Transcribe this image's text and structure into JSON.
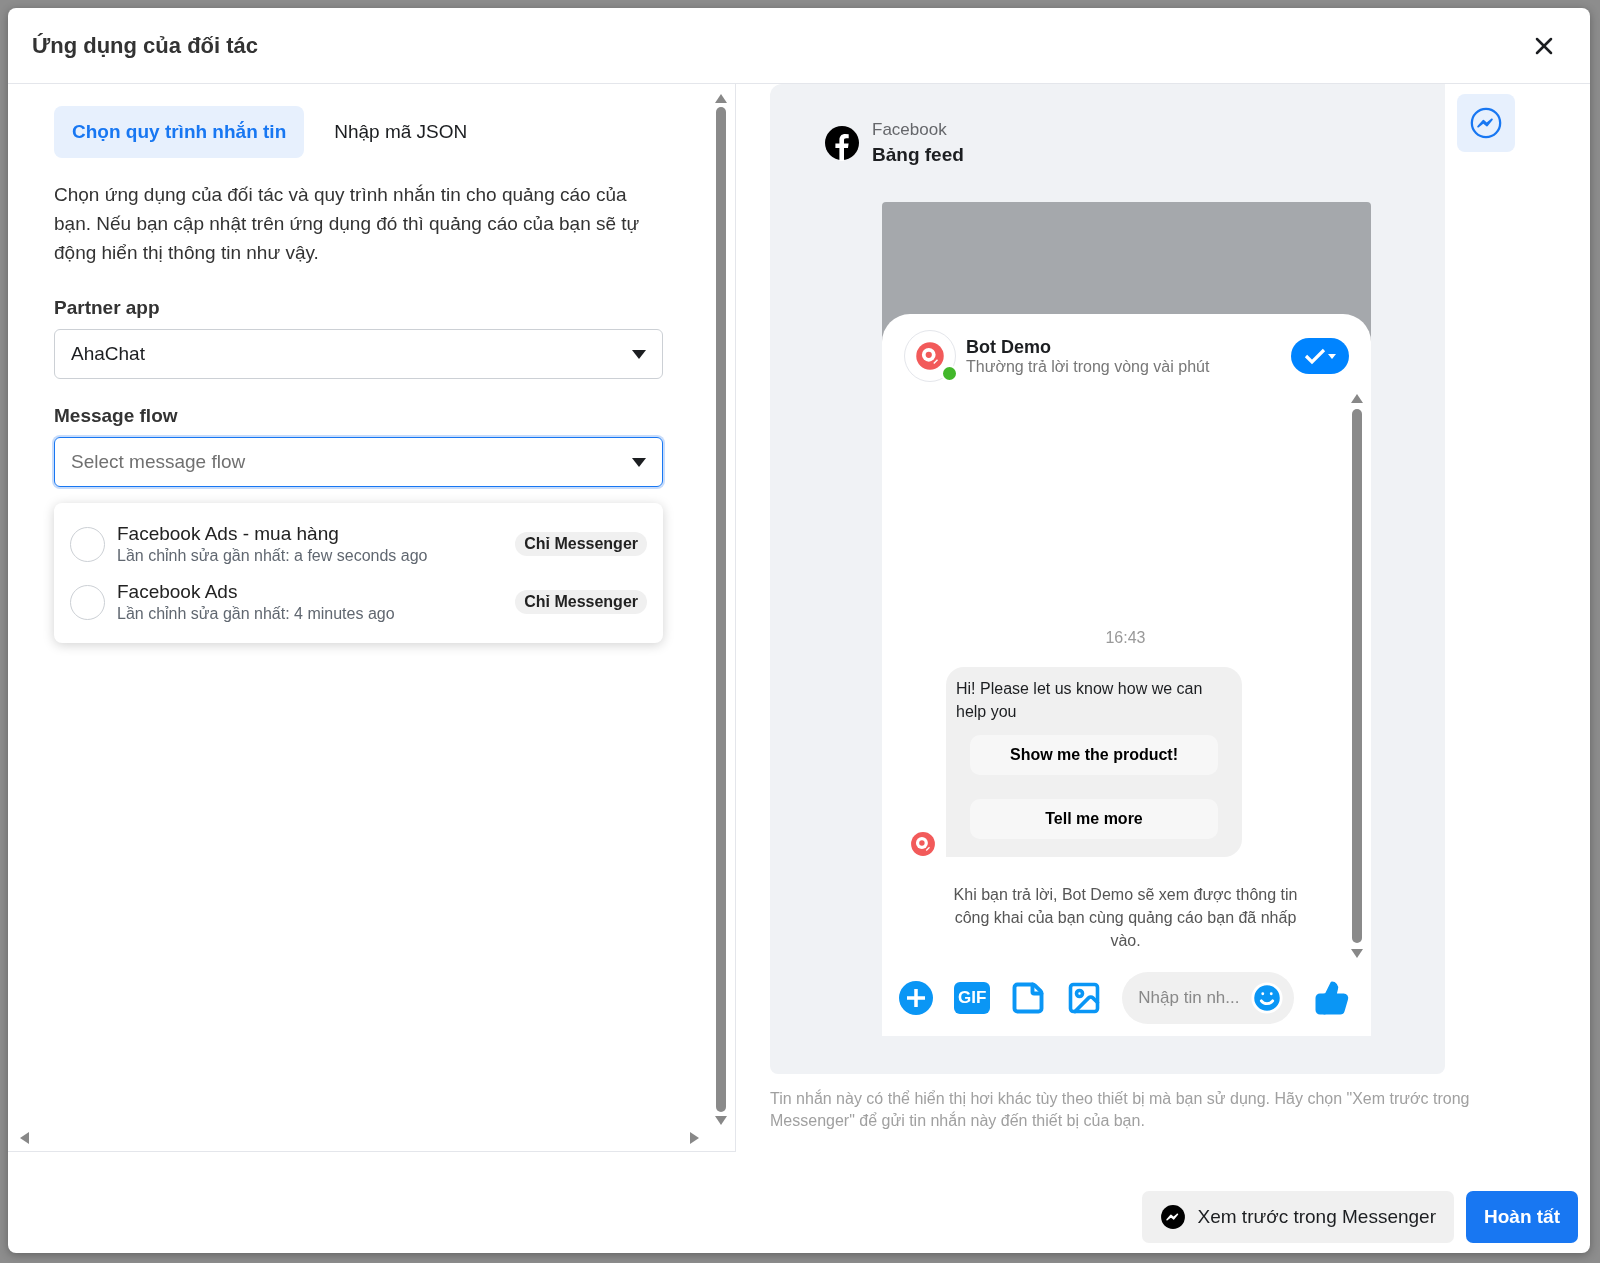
{
  "dialog": {
    "title": "Ứng dụng của đối tác"
  },
  "tabs": [
    {
      "label": "Chọn quy trình nhắn tin",
      "selected": true
    },
    {
      "label": "Nhập mã JSON",
      "selected": false
    }
  ],
  "description": "Chọn ứng dụng của đối tác và quy trình nhắn tin cho quảng cáo của bạn. Nếu bạn cập nhật trên ứng dụng đó thì quảng cáo của bạn sẽ tự động hiển thị thông tin như vậy.",
  "partner_app": {
    "label": "Partner app",
    "value": "AhaChat"
  },
  "message_flow": {
    "label": "Message flow",
    "placeholder": "Select message flow",
    "focused": true
  },
  "flow_options": [
    {
      "name": "Facebook Ads - mua hàng",
      "edited": "Lần chỉnh sửa gần nhất: a few seconds ago",
      "badge": "Chỉ Messenger",
      "selected": false
    },
    {
      "name": "Facebook Ads",
      "edited": "Lần chỉnh sửa gần nhất: 4 minutes ago",
      "badge": "Chỉ Messenger",
      "selected": false
    }
  ],
  "preview": {
    "platform": "Facebook",
    "placement": "Bảng feed",
    "page_name": "Bot Demo",
    "status": "Thường trả lời trong vòng vài phút",
    "online": true,
    "time": "16:43",
    "message": "Hi! Please let us know how we can help you",
    "quick_replies": [
      "Show me the product!",
      "Tell me more"
    ],
    "notice": "Khi bạn trả lời, Bot Demo sẽ xem được thông tin công khai của bạn cùng quảng cáo bạn đã nhấp vào.",
    "gif_label": "GIF",
    "composer_placeholder": "Nhập tin nh..."
  },
  "preview_note": "Tin nhắn này có thể hiển thị hơi khác tùy theo thiết bị mà bạn sử dụng. Hãy chọn \"Xem trước trong Messenger\" để gửi tin nhắn này đến thiết bị của bạn.",
  "buttons": [
    {
      "label": "Xem trước trong Messenger",
      "kind": "secondary"
    },
    {
      "label": "Hoàn tất",
      "kind": "primary"
    }
  ]
}
